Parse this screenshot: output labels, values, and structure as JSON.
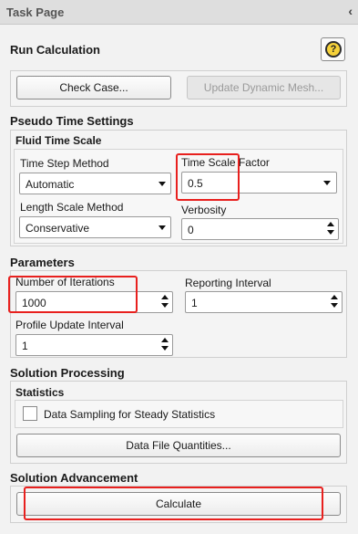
{
  "window": {
    "title": "Task Page",
    "collapse_glyph": "‹"
  },
  "header": {
    "title": "Run Calculation",
    "help_glyph": "?"
  },
  "top_buttons": {
    "check_case": "Check Case...",
    "update_dynamic_mesh": "Update Dynamic Mesh..."
  },
  "pseudo_time": {
    "title": "Pseudo Time Settings",
    "fluid_time_scale": {
      "title": "Fluid Time Scale",
      "time_step_method": {
        "label": "Time Step Method",
        "value": "Automatic"
      },
      "time_scale_factor": {
        "label": "Time Scale Factor",
        "value": "0.5"
      },
      "length_scale_method": {
        "label": "Length Scale Method",
        "value": "Conservative"
      },
      "verbosity": {
        "label": "Verbosity",
        "value": "0"
      }
    }
  },
  "parameters": {
    "title": "Parameters",
    "number_of_iterations": {
      "label": "Number of Iterations",
      "value": "1000"
    },
    "reporting_interval": {
      "label": "Reporting Interval",
      "value": "1"
    },
    "profile_update_interval": {
      "label": "Profile Update Interval",
      "value": "1"
    }
  },
  "solution_processing": {
    "title": "Solution Processing",
    "statistics": {
      "title": "Statistics",
      "checkbox_label": "Data Sampling for Steady Statistics",
      "checked": false
    },
    "data_file_quantities": "Data File Quantities..."
  },
  "solution_advancement": {
    "title": "Solution Advancement",
    "calculate": "Calculate"
  },
  "colors": {
    "highlight": "#e8201e",
    "help_icon": "#f6d23a"
  }
}
